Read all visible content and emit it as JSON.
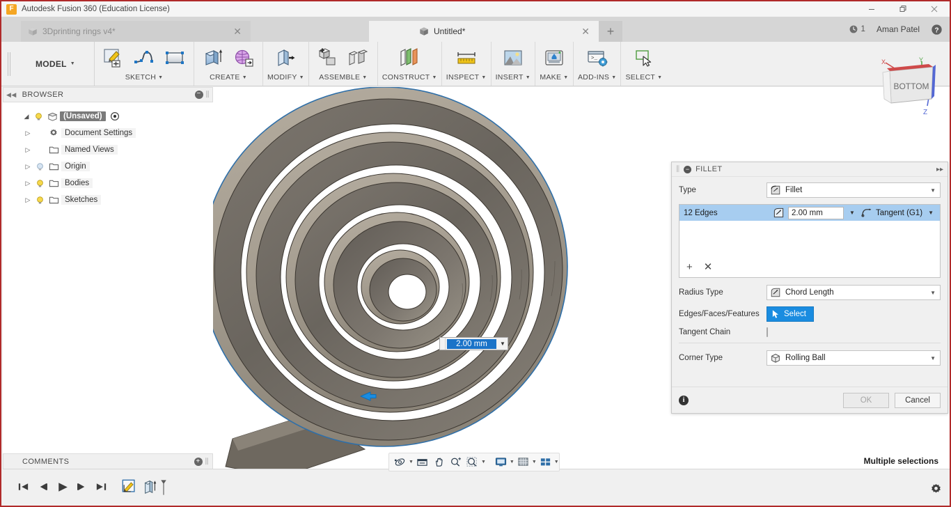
{
  "window": {
    "app_title": "Autodesk Fusion 360 (Education License)",
    "logo_letter": "F",
    "minimize": "—",
    "restore": "❐",
    "close": "✕"
  },
  "tabs": {
    "items": [
      {
        "label": "3Dprinting rings v4*",
        "active": false
      },
      {
        "label": "Untitled*",
        "active": true
      }
    ],
    "add_label": "+",
    "notification_count": "1",
    "username": "Aman Patel",
    "help_label": "?"
  },
  "ribbon": {
    "workspace": "MODEL",
    "groups": [
      {
        "title": "SKETCH",
        "buttons": [
          "create-sketch-icon",
          "spline-icon",
          "rectangle-icon"
        ]
      },
      {
        "title": "CREATE",
        "buttons": [
          "extrude-icon",
          "create-form-icon"
        ]
      },
      {
        "title": "MODIFY",
        "buttons": [
          "press-pull-icon"
        ]
      },
      {
        "title": "ASSEMBLE",
        "buttons": [
          "new-component-icon",
          "joint-icon"
        ]
      },
      {
        "title": "CONSTRUCT",
        "buttons": [
          "offset-plane-icon"
        ]
      },
      {
        "title": "INSPECT",
        "buttons": [
          "measure-icon"
        ]
      },
      {
        "title": "INSERT",
        "buttons": [
          "insert-image-icon"
        ]
      },
      {
        "title": "MAKE",
        "buttons": [
          "3d-print-icon"
        ]
      },
      {
        "title": "ADD-INS",
        "buttons": [
          "scripts-addins-icon"
        ]
      },
      {
        "title": "SELECT",
        "buttons": [
          "select-icon"
        ]
      }
    ]
  },
  "browser": {
    "title": "BROWSER",
    "collapse_icon": "◀◀",
    "minus_icon": "−",
    "grip_icon": "⫼",
    "root": {
      "label": "(Unsaved)",
      "bulb": "on",
      "eye": "visible"
    },
    "items": [
      {
        "label": "Document Settings",
        "icon": "gear-icon",
        "bulb": "none"
      },
      {
        "label": "Named Views",
        "icon": "folder-icon",
        "bulb": "none"
      },
      {
        "label": "Origin",
        "icon": "folder-icon",
        "bulb": "off"
      },
      {
        "label": "Bodies",
        "icon": "folder-icon",
        "bulb": "on"
      },
      {
        "label": "Sketches",
        "icon": "folder-icon",
        "bulb": "on"
      }
    ]
  },
  "comments": {
    "title": "COMMENTS",
    "plus_icon": "+",
    "grip_icon": "⫼"
  },
  "viewcube": {
    "face_label": "BOTTOM",
    "axis_x": "X",
    "axis_y": "Y",
    "axis_z": "Z"
  },
  "navbar": {
    "buttons": [
      {
        "name": "orbit-icon",
        "has_caret": true
      },
      {
        "name": "look-at-icon",
        "has_caret": false
      },
      {
        "name": "pan-icon",
        "has_caret": false
      },
      {
        "name": "zoom-icon",
        "has_caret": false
      },
      {
        "name": "zoom-window-icon",
        "has_caret": true
      },
      {
        "name": "display-settings-icon",
        "has_caret": true
      },
      {
        "name": "grid-snaps-icon",
        "has_caret": true
      },
      {
        "name": "viewports-icon",
        "has_caret": true
      }
    ]
  },
  "status": {
    "text": "Multiple selections"
  },
  "canvas_input": {
    "value": "2.00 mm",
    "selected": true
  },
  "dialog": {
    "title": "FILLET",
    "minimize_icon": "−",
    "expand_icon": "▸▸",
    "type": {
      "label": "Type",
      "value": "Fillet",
      "icon": "fillet-icon"
    },
    "edge_row": {
      "name": "12 Edges",
      "radius": "2.00 mm",
      "continuity": "Tangent (G1)",
      "radius_icon": "fillet-radius-icon",
      "continuity_icon": "tangent-icon"
    },
    "edge_actions": {
      "add": "+",
      "remove": "✕"
    },
    "radius_type": {
      "label": "Radius Type",
      "value": "Chord Length",
      "icon": "chord-length-icon"
    },
    "edges_faces": {
      "label": "Edges/Faces/Features",
      "button": "Select",
      "icon": "cursor-icon"
    },
    "tangent_chain": {
      "label": "Tangent Chain",
      "checked": false
    },
    "corner_type": {
      "label": "Corner Type",
      "value": "Rolling Ball",
      "icon": "rolling-ball-icon"
    },
    "info_icon": "i",
    "ok": "OK",
    "cancel": "Cancel"
  },
  "timeline": {
    "controls": [
      {
        "name": "go-to-beginning-icon",
        "glyph": "|◀"
      },
      {
        "name": "step-back-icon",
        "glyph": "◀|"
      },
      {
        "name": "play-icon",
        "glyph": "▶"
      },
      {
        "name": "step-forward-icon",
        "glyph": "|▶"
      },
      {
        "name": "go-to-end-icon",
        "glyph": "▶|"
      }
    ],
    "features": [
      {
        "name": "sketch-feature",
        "icon": "sketch-icon"
      },
      {
        "name": "extrude-feature",
        "icon": "extrude-icon"
      }
    ]
  },
  "colors": {
    "accent_blue": "#1a8ce0",
    "selection_row": "#a7cdf0",
    "window_border": "#b02a2a",
    "model_light": "#a39d90",
    "model_dark": "#6f6a63",
    "logo_orange": "#f5a623"
  }
}
